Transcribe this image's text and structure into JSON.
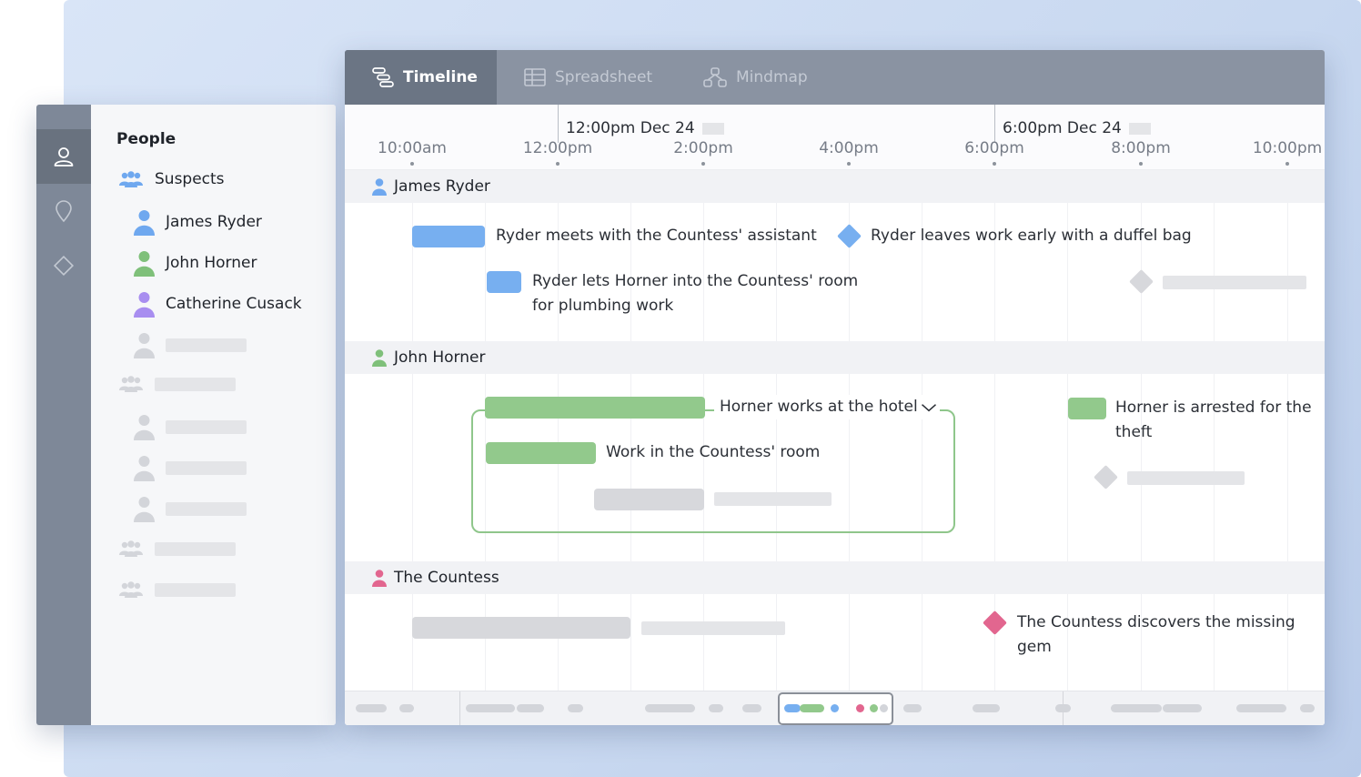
{
  "sidebar": {
    "rail_icons": [
      "person-icon",
      "map-pin-icon",
      "diamond-icon"
    ],
    "title": "People",
    "group_label": "Suspects",
    "people": [
      {
        "name": "James Ryder",
        "color": "#6fa8ef"
      },
      {
        "name": "John Horner",
        "color": "#7fc07a"
      },
      {
        "name": "Catherine Cusack",
        "color": "#a88ef0"
      }
    ]
  },
  "tabs": [
    {
      "label": "Timeline",
      "icon": "timeline-icon",
      "active": true
    },
    {
      "label": "Spreadsheet",
      "icon": "table-icon",
      "active": false
    },
    {
      "label": "Mindmap",
      "icon": "mindmap-icon",
      "active": false
    }
  ],
  "axis": {
    "dates": [
      "12:00pm Dec 24",
      "6:00pm Dec 24"
    ],
    "ticks": [
      "10:00am",
      "12:00pm",
      "2:00pm",
      "4:00pm",
      "6:00pm",
      "8:00pm",
      "10:00pm"
    ]
  },
  "lanes": [
    {
      "name": "James Ryder",
      "color": "#6fa8ef"
    },
    {
      "name": "John Horner",
      "color": "#7fc07a"
    },
    {
      "name": "The Countess",
      "color": "#e2668f"
    }
  ],
  "events": {
    "ryder_meets": "Ryder meets with the Countess' assistant",
    "ryder_leaves": "Ryder leaves work early with a duffel bag",
    "ryder_lets_1": "Ryder lets Horner into the Countess' room",
    "ryder_lets_2": "for plumbing work",
    "horner_works": "Horner works at the hotel",
    "work_countess_room": "Work in the Countess' room",
    "horner_arrested_1": "Horner is arrested for the",
    "horner_arrested_2": "theft",
    "countess_discovers_1": "The Countess discovers the missing",
    "countess_discovers_2": "gem"
  },
  "colors": {
    "blue": "#77aff0",
    "green": "#92c98c",
    "pink": "#e2668f",
    "placeholder": "#d7d8dc"
  }
}
